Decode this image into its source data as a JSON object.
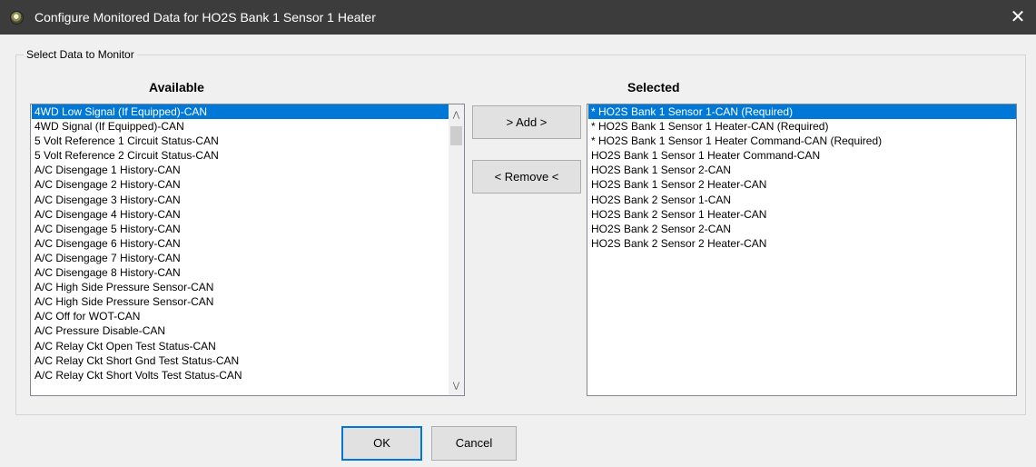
{
  "window": {
    "title": "Configure Monitored Data for HO2S Bank 1 Sensor 1 Heater",
    "close_glyph": "✕",
    "app_icon": "app-logo-icon"
  },
  "group": {
    "legend": "Select Data to Monitor"
  },
  "available": {
    "heading": "Available",
    "items": [
      "4WD Low Signal (If Equipped)-CAN",
      "4WD Signal (If Equipped)-CAN",
      "5 Volt Reference 1 Circuit Status-CAN",
      "5 Volt Reference 2 Circuit Status-CAN",
      "A/C Disengage 1 History-CAN",
      "A/C Disengage 2 History-CAN",
      "A/C Disengage 3 History-CAN",
      "A/C Disengage 4 History-CAN",
      "A/C Disengage 5 History-CAN",
      "A/C Disengage 6 History-CAN",
      "A/C Disengage 7 History-CAN",
      "A/C Disengage 8 History-CAN",
      "A/C High Side Pressure Sensor-CAN",
      "A/C High Side Pressure Sensor-CAN",
      "A/C Off for WOT-CAN",
      "A/C Pressure Disable-CAN",
      "A/C Relay Ckt Open Test Status-CAN",
      "A/C Relay Ckt Short Gnd Test Status-CAN",
      "A/C Relay Ckt Short Volts Test Status-CAN"
    ],
    "selected_index": 0
  },
  "selected": {
    "heading": "Selected",
    "items": [
      "* HO2S Bank 1 Sensor 1-CAN (Required)",
      "* HO2S Bank 1 Sensor 1 Heater-CAN (Required)",
      "* HO2S Bank 1 Sensor 1 Heater Command-CAN (Required)",
      "HO2S Bank 1 Sensor 1 Heater Command-CAN",
      "HO2S Bank 1 Sensor 2-CAN",
      "HO2S Bank 1 Sensor 2 Heater-CAN",
      "HO2S Bank 2 Sensor 1-CAN",
      "HO2S Bank 2 Sensor 1 Heater-CAN",
      "HO2S Bank 2 Sensor 2-CAN",
      "HO2S Bank 2 Sensor 2 Heater-CAN"
    ],
    "selected_index": 0
  },
  "buttons": {
    "add": "> Add >",
    "remove": "< Remove <",
    "ok": "OK",
    "cancel": "Cancel"
  },
  "scrollbar": {
    "up_glyph": "⋀",
    "down_glyph": "⋁"
  },
  "colors": {
    "titlebar": "#3c3c3c",
    "selection": "#0078d7",
    "default_button_border": "#0078d7"
  }
}
